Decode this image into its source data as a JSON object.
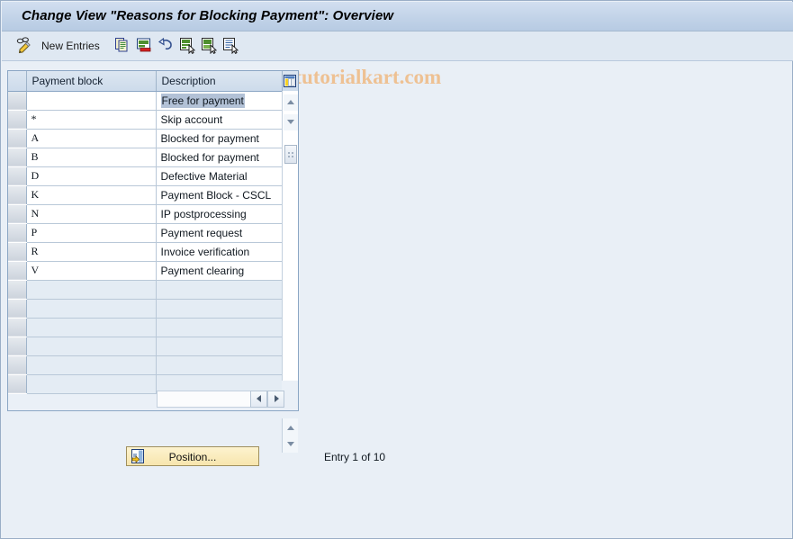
{
  "window": {
    "title": "Change View \"Reasons for Blocking Payment\": Overview"
  },
  "toolbar": {
    "display_change_icon": "pencil-glasses-icon",
    "new_entries_label": "New Entries",
    "buttons": [
      {
        "name": "copy-as-icon",
        "tooltip": "Copy As..."
      },
      {
        "name": "delete-icon",
        "tooltip": "Delete"
      },
      {
        "name": "undo-icon",
        "tooltip": "Undo Change"
      },
      {
        "name": "select-all-icon",
        "tooltip": "Select All"
      },
      {
        "name": "select-block-icon",
        "tooltip": "Select Block"
      },
      {
        "name": "deselect-all-icon",
        "tooltip": "Deselect All"
      }
    ]
  },
  "watermark": {
    "text": "www.tutorialkart.com",
    "color": "#eec193"
  },
  "table": {
    "config_icon": "table-settings-icon",
    "columns": [
      {
        "key": "payment_block",
        "label": "Payment block"
      },
      {
        "key": "description",
        "label": "Description"
      }
    ],
    "rows": [
      {
        "payment_block": "",
        "description": "Free for payment",
        "selected": true,
        "filled": true
      },
      {
        "payment_block": "*",
        "description": "Skip account",
        "selected": false,
        "filled": true
      },
      {
        "payment_block": "A",
        "description": "Blocked for payment",
        "selected": false,
        "filled": true
      },
      {
        "payment_block": "B",
        "description": "Blocked for payment",
        "selected": false,
        "filled": true
      },
      {
        "payment_block": "D",
        "description": "Defective Material",
        "selected": false,
        "filled": true
      },
      {
        "payment_block": "K",
        "description": "Payment Block - CSCL",
        "selected": false,
        "filled": true
      },
      {
        "payment_block": "N",
        "description": "IP postprocessing",
        "selected": false,
        "filled": true
      },
      {
        "payment_block": "P",
        "description": "Payment request",
        "selected": false,
        "filled": true
      },
      {
        "payment_block": "R",
        "description": "Invoice verification",
        "selected": false,
        "filled": true
      },
      {
        "payment_block": "V",
        "description": "Payment clearing",
        "selected": false,
        "filled": true
      },
      {
        "payment_block": "",
        "description": "",
        "selected": false,
        "filled": false
      },
      {
        "payment_block": "",
        "description": "",
        "selected": false,
        "filled": false
      },
      {
        "payment_block": "",
        "description": "",
        "selected": false,
        "filled": false
      },
      {
        "payment_block": "",
        "description": "",
        "selected": false,
        "filled": false
      },
      {
        "payment_block": "",
        "description": "",
        "selected": false,
        "filled": false
      },
      {
        "payment_block": "",
        "description": "",
        "selected": false,
        "filled": false
      }
    ]
  },
  "footer": {
    "position_button_label": "Position...",
    "position_icon": "position-jump-icon",
    "entry_status": "Entry 1 of 10"
  },
  "scrollbars": {
    "vertical_up_icon": "scroll-up-icon",
    "vertical_down_icon": "scroll-down-icon",
    "horizontal_left_icon": "scroll-left-icon",
    "horizontal_right_icon": "scroll-right-icon"
  }
}
